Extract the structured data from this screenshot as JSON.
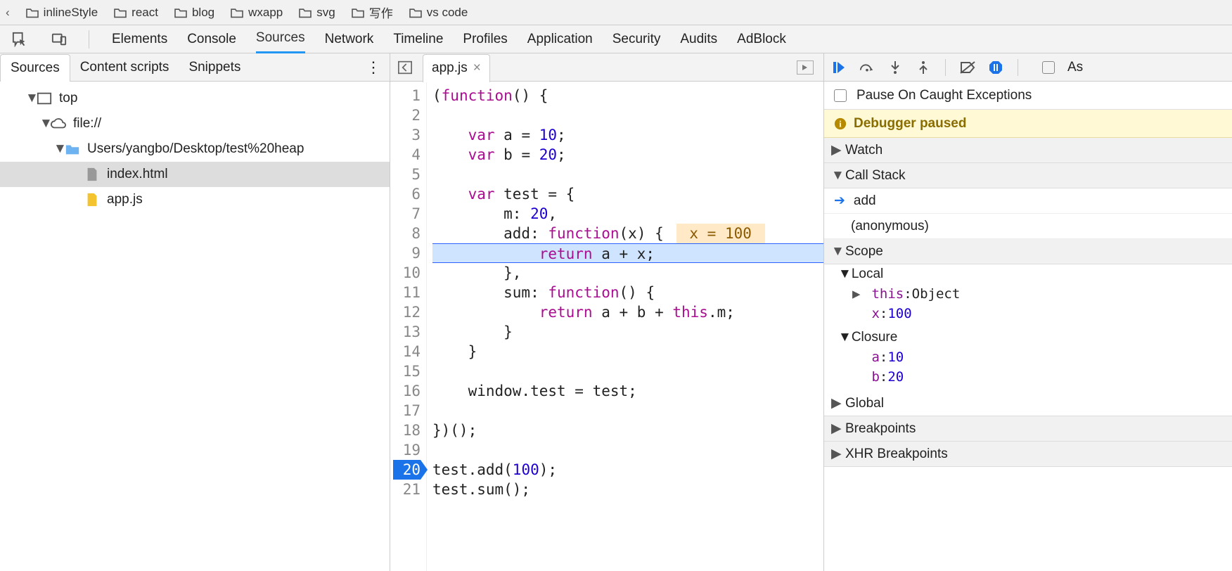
{
  "bookmarks": [
    "inlineStyle",
    "react",
    "blog",
    "wxapp",
    "svg",
    "写作",
    "vs code"
  ],
  "devtools_tabs": [
    "Elements",
    "Console",
    "Sources",
    "Network",
    "Timeline",
    "Profiles",
    "Application",
    "Security",
    "Audits",
    "AdBlock"
  ],
  "devtools_active_tab": "Sources",
  "left_tabs": [
    "Sources",
    "Content scripts",
    "Snippets"
  ],
  "left_active_tab": "Sources",
  "file_tree": {
    "root": "top",
    "origin": "file://",
    "folder": "Users/yangbo/Desktop/test%20heap",
    "files": [
      "index.html",
      "app.js"
    ],
    "selected": "index.html"
  },
  "open_file_tab": "app.js",
  "code_lines": [
    "(function() {",
    "",
    "    var a = 10;",
    "    var b = 20;",
    "",
    "    var test = {",
    "        m: 20,",
    "        add: function(x) {",
    "            return a + x;",
    "        },",
    "        sum: function() {",
    "            return a + b + this.m;",
    "        }",
    "    }",
    "",
    "    window.test = test;",
    "",
    "})();",
    "",
    "test.add(100);",
    "test.sum();"
  ],
  "execution_line": 9,
  "breakpoint_line": 20,
  "inline_overlay": {
    "line": 8,
    "text": "x = 100"
  },
  "right": {
    "pause_on_caught": "Pause On Caught Exceptions",
    "banner": "Debugger paused",
    "watch": "Watch",
    "call_stack_label": "Call Stack",
    "call_stack": [
      "add",
      "(anonymous)"
    ],
    "scope_label": "Scope",
    "scope_local_label": "Local",
    "scope_local": {
      "this_label": "this",
      "this_value": "Object",
      "x_label": "x",
      "x_value": "100"
    },
    "scope_closure_label": "Closure",
    "scope_closure": {
      "a_label": "a",
      "a_value": "10",
      "b_label": "b",
      "b_value": "20"
    },
    "global_label": "Global",
    "breakpoints_label": "Breakpoints",
    "xhr_bp_label": "XHR Breakpoints",
    "async_label": "As"
  }
}
